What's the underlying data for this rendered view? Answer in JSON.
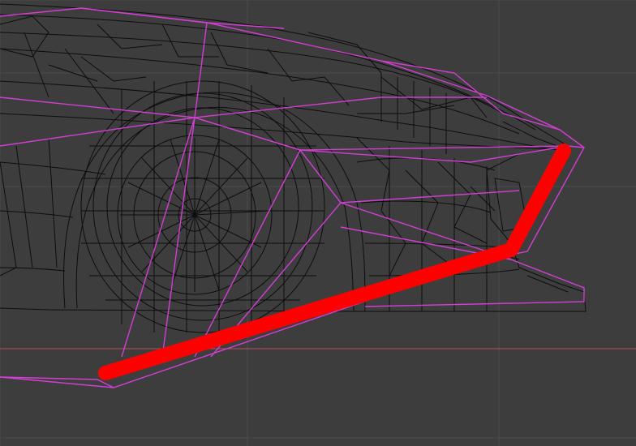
{
  "viewport": {
    "background": "#3d3d3d",
    "grid_color": "#4a4a4a",
    "axis_color": "#b8505a",
    "wire_color": "#0d0d0d",
    "cage_color": "#d23fd2",
    "stroke_color": "#ff0000"
  },
  "icons": {
    "model": "car-wireframe",
    "wheel": "wheel-wireframe",
    "annotation": "red-stroke"
  }
}
